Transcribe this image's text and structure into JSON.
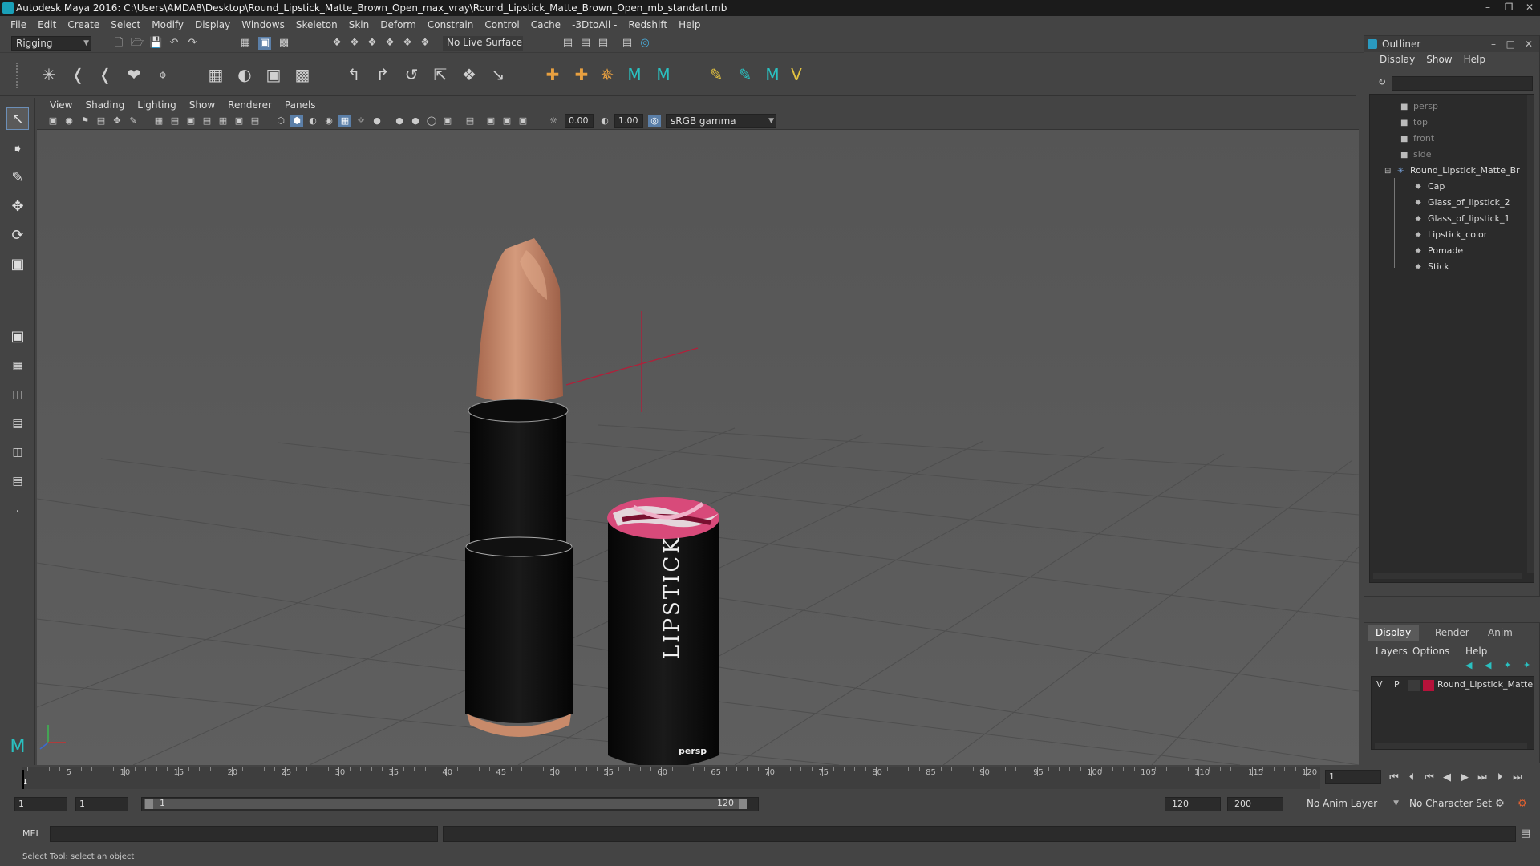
{
  "title_bar": {
    "title": "Autodesk Maya 2016: C:\\Users\\AMDA8\\Desktop\\Round_Lipstick_Matte_Brown_Open_max_vray\\Round_Lipstick_Matte_Brown_Open_mb_standart.mb"
  },
  "menu": [
    "File",
    "Edit",
    "Create",
    "Select",
    "Modify",
    "Display",
    "Windows",
    "Skeleton",
    "Skin",
    "Deform",
    "Constrain",
    "Control",
    "Cache",
    "-3DtoAll -",
    "Redshift",
    "Help"
  ],
  "status_line": {
    "menu_set": "Rigging",
    "live_surface": "No Live Surface"
  },
  "viewport": {
    "menus": [
      "View",
      "Shading",
      "Lighting",
      "Show",
      "Renderer",
      "Panels"
    ],
    "exposure": "0.00",
    "gamma": "1.00",
    "color_space": "sRGB gamma",
    "camera_label": "persp",
    "cap_label": "LIPSTICK"
  },
  "outliner": {
    "title": "Outliner",
    "menus": [
      "Display",
      "Show",
      "Help"
    ],
    "cameras": [
      "persp",
      "top",
      "front",
      "side"
    ],
    "group": "Round_Lipstick_Matte_Br",
    "children": [
      "Cap",
      "Glass_of_lipstick_2",
      "Glass_of_lipstick_1",
      "Lipstick_color",
      "Pomade",
      "Stick"
    ]
  },
  "layer_editor": {
    "tabs": [
      "Display",
      "Render",
      "Anim"
    ],
    "menus": [
      "Layers",
      "Options",
      "Help"
    ],
    "layer": {
      "v": "V",
      "p": "P",
      "name": "Round_Lipstick_Matte",
      "color": "#b5123a"
    }
  },
  "time_slider": {
    "ticks": [
      "5",
      "10",
      "15",
      "20",
      "25",
      "30",
      "35",
      "40",
      "45",
      "50",
      "55",
      "60",
      "65",
      "70",
      "75",
      "80",
      "85",
      "90",
      "95",
      "100",
      "105",
      "110",
      "115",
      "120"
    ],
    "start_label": "1",
    "current_frame": "1"
  },
  "range_slider": {
    "start_frame": "1",
    "playback_start": "1",
    "range_start_label": "1",
    "range_end_label": "120",
    "playback_end": "120",
    "end_frame": "200",
    "anim_layer": "No Anim Layer",
    "character_set": "No Character Set"
  },
  "command_line": {
    "label": "MEL"
  },
  "help_line": {
    "text": "Select Tool: select an object"
  },
  "colors": {
    "accent": "#5b7fa8",
    "lipstick": "#c98a6c",
    "layer_swatch": "#b5123a"
  }
}
